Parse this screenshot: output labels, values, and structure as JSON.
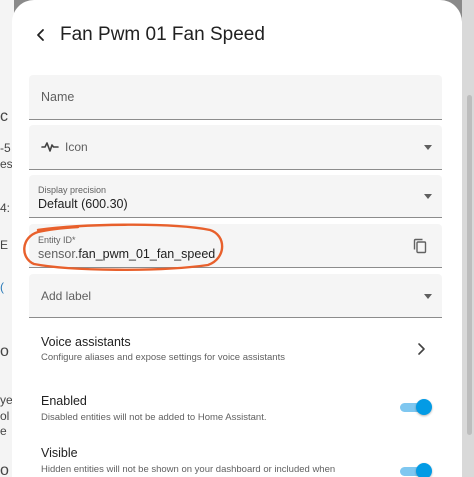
{
  "background": {
    "fragments": [
      "c",
      "-5",
      "es",
      "4:",
      "E",
      "(",
      "o",
      "ye",
      "ol",
      "e",
      "o"
    ]
  },
  "dialog": {
    "title": "Fan Pwm 01 Fan Speed",
    "fields": {
      "name": {
        "placeholder": "Name"
      },
      "icon": {
        "placeholder": "Icon"
      },
      "display_precision": {
        "label": "Display precision",
        "value": "Default (600.30)"
      },
      "entity_id": {
        "label": "Entity ID*",
        "prefix": "sensor.",
        "value": "fan_pwm_01_fan_speed"
      },
      "add_label": {
        "placeholder": "Add label"
      }
    },
    "voice_assistants": {
      "title": "Voice assistants",
      "subtitle": "Configure aliases and expose settings for voice assistants"
    },
    "enabled": {
      "title": "Enabled",
      "subtitle": "Disabled entities will not be added to Home Assistant.",
      "on": true
    },
    "visible": {
      "title": "Visible",
      "subtitle": "Hidden entities will not be shown on your dashboard or included when",
      "on": true
    }
  },
  "colors": {
    "accent": "#039be5",
    "annotation": "#e8602c"
  }
}
